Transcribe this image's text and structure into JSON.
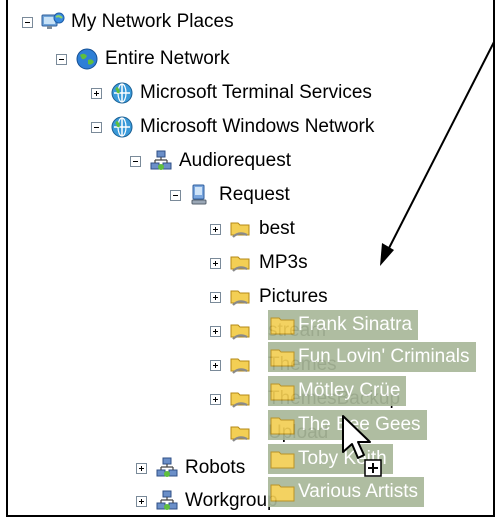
{
  "tree": {
    "my_network_places": "My Network Places",
    "entire_network": "Entire Network",
    "terminal_services": "Microsoft Terminal Services",
    "windows_network": "Microsoft Windows Network",
    "audiorequest": "Audiorequest",
    "request": "Request",
    "best": "best",
    "mp3s": "MP3s",
    "pictures": "Pictures",
    "stream": "stream",
    "themes": "Themes",
    "themesbackup": "ThemesBackup",
    "upload": "Upload",
    "robots": "Robots",
    "workgroup": "Workgroup"
  },
  "drag_items": [
    "Frank Sinatra",
    "Fun Lovin' Criminals",
    "Mötley Crüe",
    "The Bee Gees",
    "Toby Keith",
    "Various Artists"
  ],
  "icons": [
    "network-places-icon",
    "globe-icon",
    "network-globe-icon",
    "workgroup-icon",
    "computer-icon",
    "shared-folder-icon",
    "folder-icon",
    "arrow-cursor-icon",
    "copy-plus-icon"
  ],
  "colors": {
    "drag_highlight": "#a9b89a",
    "folder": "#f3cf54",
    "annotation_arrow": "#000000"
  }
}
